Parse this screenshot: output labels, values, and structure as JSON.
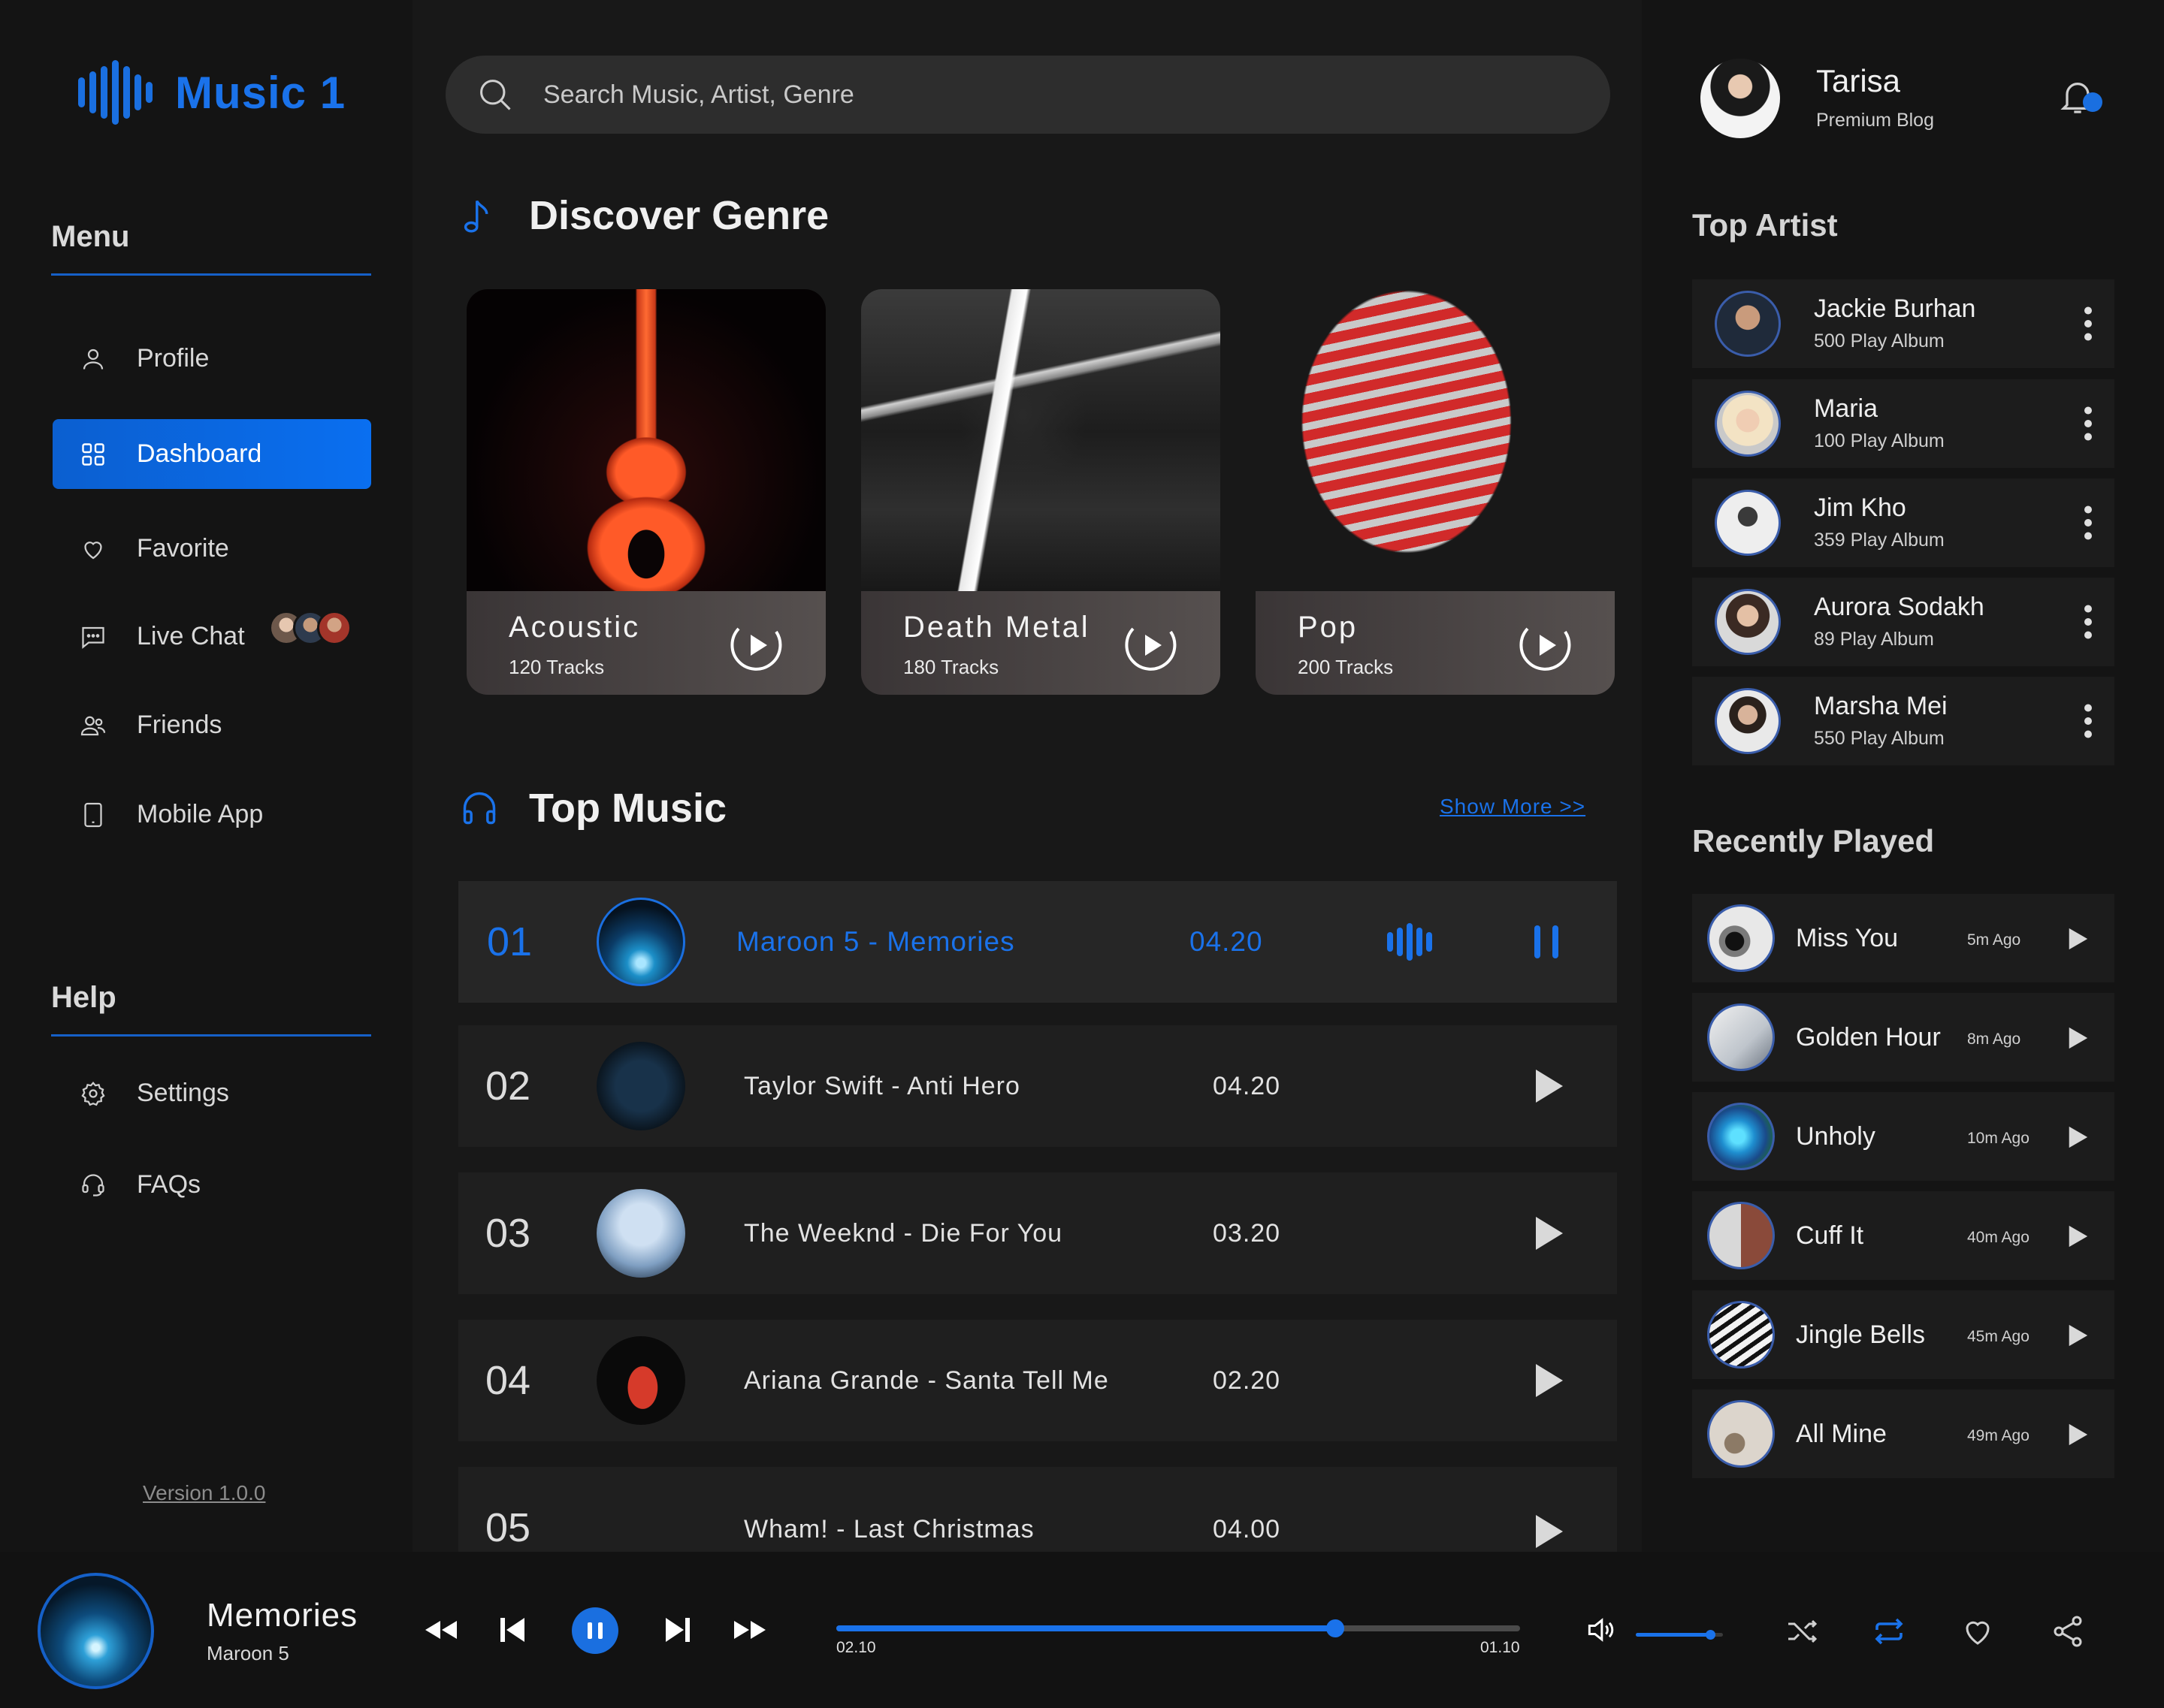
{
  "app": {
    "name": "Music 1"
  },
  "menu": {
    "title": "Menu",
    "items": [
      {
        "label": "Profile",
        "icon": "user-icon"
      },
      {
        "label": "Dashboard",
        "icon": "grid-icon",
        "active": true
      },
      {
        "label": "Favorite",
        "icon": "heart-icon"
      },
      {
        "label": "Live Chat",
        "icon": "chat-icon"
      },
      {
        "label": "Friends",
        "icon": "friends-icon"
      },
      {
        "label": "Mobile App",
        "icon": "mobile-icon"
      }
    ]
  },
  "help": {
    "title": "Help",
    "items": [
      {
        "label": "Settings",
        "icon": "gear-icon"
      },
      {
        "label": "FAQs",
        "icon": "headset-icon"
      }
    ]
  },
  "version": "Version 1.0.0",
  "search": {
    "placeholder": "Search Music, Artist, Genre"
  },
  "discover": {
    "title": "Discover Genre",
    "genres": [
      {
        "name": "Acoustic",
        "tracks": "120 Tracks"
      },
      {
        "name": "Death Metal",
        "tracks": "180 Tracks"
      },
      {
        "name": "Pop",
        "tracks": "200 Tracks"
      }
    ]
  },
  "top_music": {
    "title": "Top Music",
    "show_more": "Show More >>",
    "tracks": [
      {
        "num": "01",
        "title": "Maroon 5 - Memories",
        "time": "04.20",
        "playing": true
      },
      {
        "num": "02",
        "title": "Taylor Swift - Anti Hero",
        "time": "04.20"
      },
      {
        "num": "03",
        "title": "The Weeknd - Die For You",
        "time": "03.20"
      },
      {
        "num": "04",
        "title": "Ariana Grande - Santa Tell Me",
        "time": "02.20"
      },
      {
        "num": "05",
        "title": "Wham! - Last Christmas",
        "time": "04.00"
      }
    ]
  },
  "user": {
    "name": "Tarisa",
    "subtitle": "Premium Blog"
  },
  "top_artist": {
    "title": "Top Artist",
    "artists": [
      {
        "name": "Jackie Burhan",
        "plays": "500 Play Album"
      },
      {
        "name": "Maria",
        "plays": "100 Play Album"
      },
      {
        "name": "Jim Kho",
        "plays": "359 Play Album"
      },
      {
        "name": "Aurora Sodakh",
        "plays": "89 Play Album"
      },
      {
        "name": "Marsha Mei",
        "plays": "550 Play Album"
      }
    ]
  },
  "recently_played": {
    "title": "Recently Played",
    "items": [
      {
        "name": "Miss You",
        "ago": "5m Ago"
      },
      {
        "name": "Golden Hour",
        "ago": "8m Ago"
      },
      {
        "name": "Unholy",
        "ago": "10m Ago"
      },
      {
        "name": "Cuff It",
        "ago": "40m Ago"
      },
      {
        "name": "Jingle Bells",
        "ago": "45m Ago"
      },
      {
        "name": "All Mine",
        "ago": "49m Ago"
      }
    ]
  },
  "player": {
    "title": "Memories",
    "artist": "Maroon 5",
    "elapsed": "02.10",
    "remaining": "01.10",
    "progress": 0.73,
    "volume": 0.85
  },
  "colors": {
    "accent": "#1a72ea",
    "background": "#121212",
    "panel": "#181818"
  }
}
